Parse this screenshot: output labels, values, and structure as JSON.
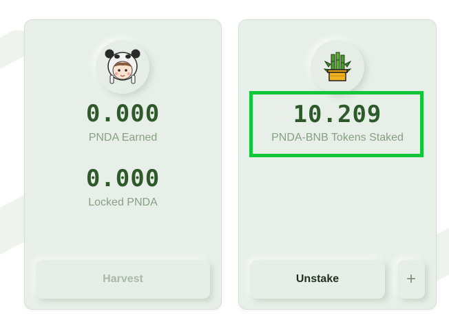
{
  "earned_card": {
    "earned_value": "0.000",
    "earned_label": "PNDA Earned",
    "locked_value": "0.000",
    "locked_label": "Locked PNDA",
    "harvest_label": "Harvest"
  },
  "staked_card": {
    "staked_value": "10.209",
    "staked_label": "PNDA-BNB Tokens Staked",
    "unstake_label": "Unstake",
    "plus_label": "+"
  },
  "icons": {
    "earned_avatar": "panda-mascot-icon",
    "staked_avatar": "bamboo-pot-icon"
  },
  "colors": {
    "value_text": "#2e5a2b",
    "label_text": "#86a083",
    "card_bg": "#e8efe8",
    "highlight": "#12c63a"
  }
}
